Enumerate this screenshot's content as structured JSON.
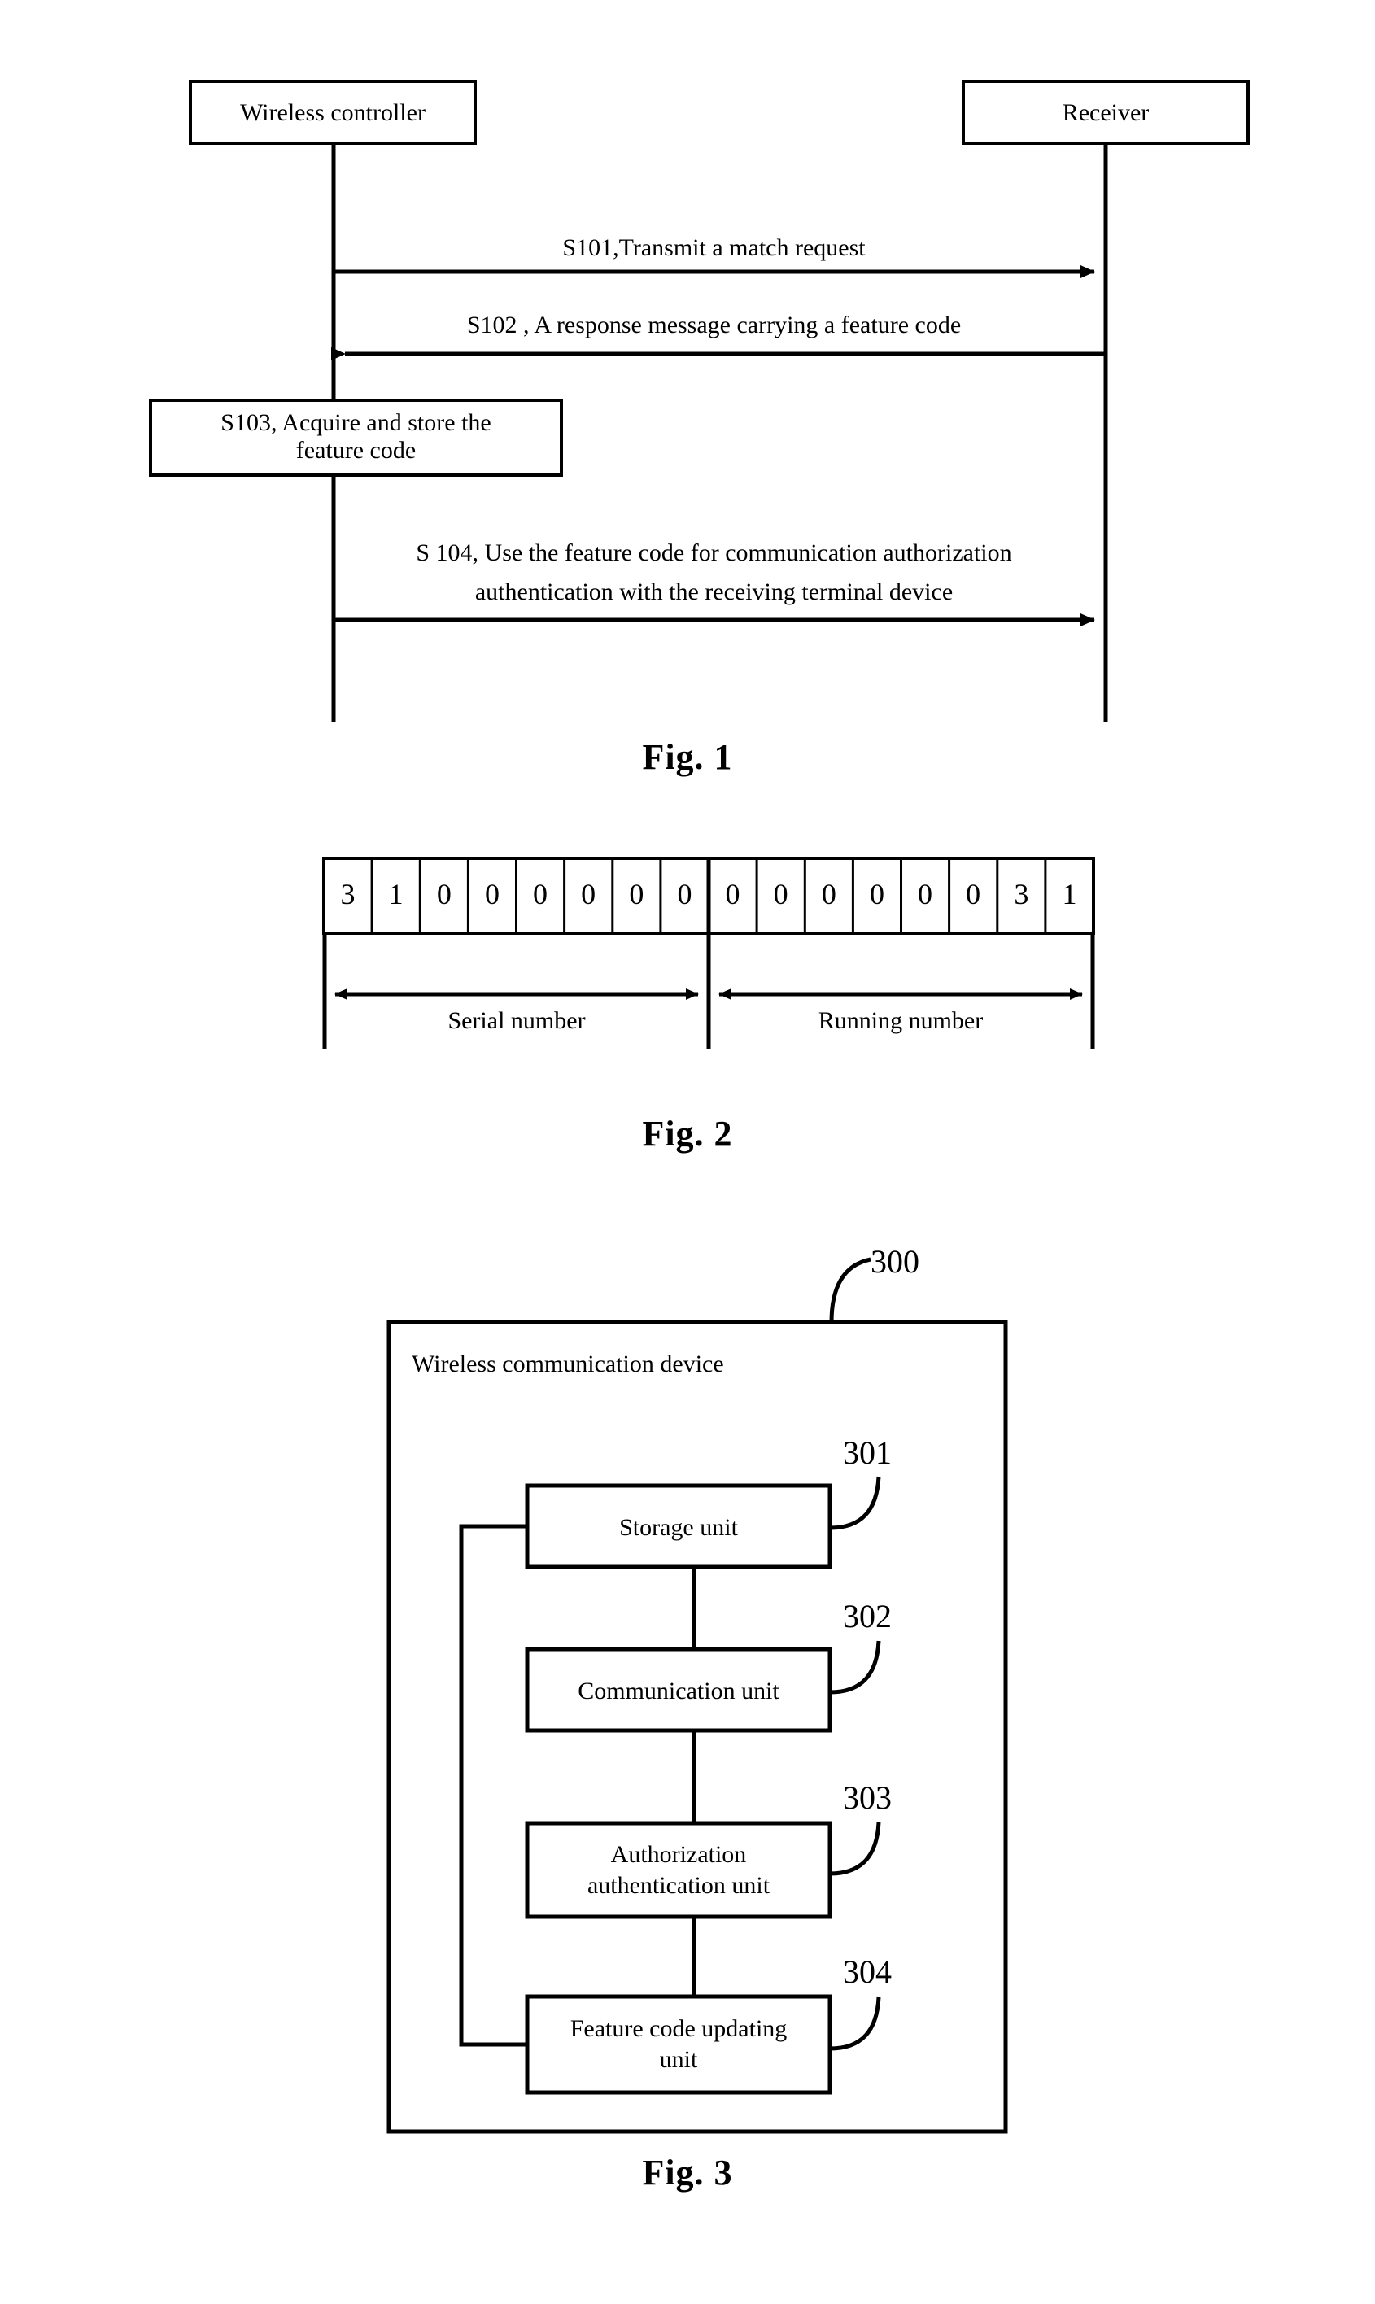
{
  "document": {
    "type": "patent-drawing-sheet",
    "ink_color": "#000000",
    "background_color": "#ffffff"
  },
  "figure1": {
    "caption": "Fig. 1",
    "actors": [
      {
        "id": "wireless-controller",
        "label": "Wireless controller"
      },
      {
        "id": "receiver",
        "label": "Receiver"
      }
    ],
    "messages": [
      {
        "id": "s101",
        "label": "S101,Transmit a match request",
        "direction": "left-to-right"
      },
      {
        "id": "s102",
        "label": "S102 , A response message carrying a feature code",
        "direction": "right-to-left"
      },
      {
        "id": "s104",
        "line1": "S 104, Use the feature code for communication authorization",
        "line2": "authentication with the receiving terminal device",
        "direction": "left-to-right"
      }
    ],
    "self_action": {
      "id": "s103",
      "line1": "S103, Acquire and store the",
      "line2": "feature code"
    }
  },
  "figure2": {
    "caption": "Fig. 2",
    "cells": [
      "3",
      "1",
      "0",
      "0",
      "0",
      "0",
      "0",
      "0",
      "0",
      "0",
      "0",
      "0",
      "0",
      "0",
      "3",
      "1"
    ],
    "spans": [
      {
        "id": "serial-number",
        "label": "Serial number",
        "cells": 8
      },
      {
        "id": "running-number",
        "label": "Running number",
        "cells": 8
      }
    ]
  },
  "figure3": {
    "caption": "Fig. 3",
    "device": {
      "ref": "300",
      "label": "Wireless communication device"
    },
    "units": [
      {
        "ref": "301",
        "label": "Storage unit",
        "line1": "Storage unit",
        "line2": ""
      },
      {
        "ref": "302",
        "label": "Communication unit",
        "line1": "Communication unit",
        "line2": ""
      },
      {
        "ref": "303",
        "label": "Authorization authentication unit",
        "line1": "Authorization",
        "line2": "authentication unit"
      },
      {
        "ref": "304",
        "label": "Feature code updating unit",
        "line1": "Feature code updating",
        "line2": "unit"
      }
    ]
  }
}
